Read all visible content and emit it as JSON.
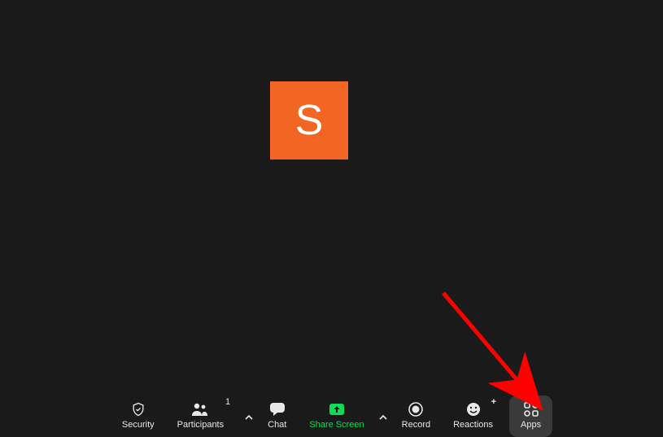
{
  "avatar": {
    "initial": "S",
    "bg_color": "#f26522"
  },
  "toolbar": {
    "security": {
      "label": "Security"
    },
    "participants": {
      "label": "Participants",
      "count": "1"
    },
    "chat": {
      "label": "Chat"
    },
    "share": {
      "label": "Share Screen"
    },
    "record": {
      "label": "Record"
    },
    "reactions": {
      "label": "Reactions"
    },
    "apps": {
      "label": "Apps"
    }
  },
  "annotation": {
    "arrow_color": "#ff0000"
  }
}
